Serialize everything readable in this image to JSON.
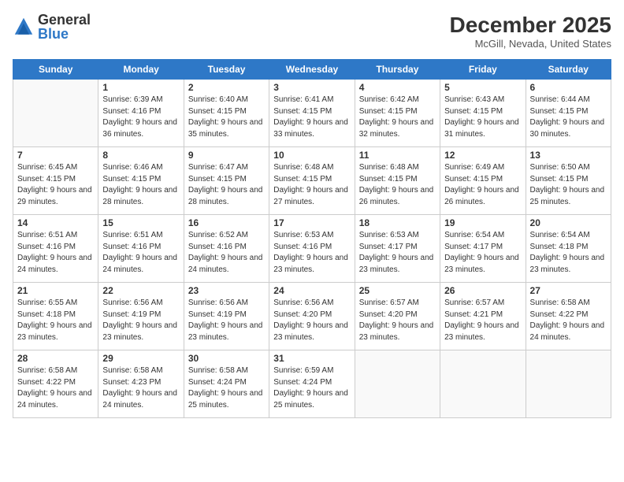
{
  "logo": {
    "general": "General",
    "blue": "Blue"
  },
  "title": "December 2025",
  "location": "McGill, Nevada, United States",
  "days_header": [
    "Sunday",
    "Monday",
    "Tuesday",
    "Wednesday",
    "Thursday",
    "Friday",
    "Saturday"
  ],
  "weeks": [
    [
      {
        "day": "",
        "sunrise": "",
        "sunset": "",
        "daylight": ""
      },
      {
        "day": "1",
        "sunrise": "Sunrise: 6:39 AM",
        "sunset": "Sunset: 4:16 PM",
        "daylight": "Daylight: 9 hours and 36 minutes."
      },
      {
        "day": "2",
        "sunrise": "Sunrise: 6:40 AM",
        "sunset": "Sunset: 4:15 PM",
        "daylight": "Daylight: 9 hours and 35 minutes."
      },
      {
        "day": "3",
        "sunrise": "Sunrise: 6:41 AM",
        "sunset": "Sunset: 4:15 PM",
        "daylight": "Daylight: 9 hours and 33 minutes."
      },
      {
        "day": "4",
        "sunrise": "Sunrise: 6:42 AM",
        "sunset": "Sunset: 4:15 PM",
        "daylight": "Daylight: 9 hours and 32 minutes."
      },
      {
        "day": "5",
        "sunrise": "Sunrise: 6:43 AM",
        "sunset": "Sunset: 4:15 PM",
        "daylight": "Daylight: 9 hours and 31 minutes."
      },
      {
        "day": "6",
        "sunrise": "Sunrise: 6:44 AM",
        "sunset": "Sunset: 4:15 PM",
        "daylight": "Daylight: 9 hours and 30 minutes."
      }
    ],
    [
      {
        "day": "7",
        "sunrise": "Sunrise: 6:45 AM",
        "sunset": "Sunset: 4:15 PM",
        "daylight": "Daylight: 9 hours and 29 minutes."
      },
      {
        "day": "8",
        "sunrise": "Sunrise: 6:46 AM",
        "sunset": "Sunset: 4:15 PM",
        "daylight": "Daylight: 9 hours and 28 minutes."
      },
      {
        "day": "9",
        "sunrise": "Sunrise: 6:47 AM",
        "sunset": "Sunset: 4:15 PM",
        "daylight": "Daylight: 9 hours and 28 minutes."
      },
      {
        "day": "10",
        "sunrise": "Sunrise: 6:48 AM",
        "sunset": "Sunset: 4:15 PM",
        "daylight": "Daylight: 9 hours and 27 minutes."
      },
      {
        "day": "11",
        "sunrise": "Sunrise: 6:48 AM",
        "sunset": "Sunset: 4:15 PM",
        "daylight": "Daylight: 9 hours and 26 minutes."
      },
      {
        "day": "12",
        "sunrise": "Sunrise: 6:49 AM",
        "sunset": "Sunset: 4:15 PM",
        "daylight": "Daylight: 9 hours and 26 minutes."
      },
      {
        "day": "13",
        "sunrise": "Sunrise: 6:50 AM",
        "sunset": "Sunset: 4:15 PM",
        "daylight": "Daylight: 9 hours and 25 minutes."
      }
    ],
    [
      {
        "day": "14",
        "sunrise": "Sunrise: 6:51 AM",
        "sunset": "Sunset: 4:16 PM",
        "daylight": "Daylight: 9 hours and 24 minutes."
      },
      {
        "day": "15",
        "sunrise": "Sunrise: 6:51 AM",
        "sunset": "Sunset: 4:16 PM",
        "daylight": "Daylight: 9 hours and 24 minutes."
      },
      {
        "day": "16",
        "sunrise": "Sunrise: 6:52 AM",
        "sunset": "Sunset: 4:16 PM",
        "daylight": "Daylight: 9 hours and 24 minutes."
      },
      {
        "day": "17",
        "sunrise": "Sunrise: 6:53 AM",
        "sunset": "Sunset: 4:16 PM",
        "daylight": "Daylight: 9 hours and 23 minutes."
      },
      {
        "day": "18",
        "sunrise": "Sunrise: 6:53 AM",
        "sunset": "Sunset: 4:17 PM",
        "daylight": "Daylight: 9 hours and 23 minutes."
      },
      {
        "day": "19",
        "sunrise": "Sunrise: 6:54 AM",
        "sunset": "Sunset: 4:17 PM",
        "daylight": "Daylight: 9 hours and 23 minutes."
      },
      {
        "day": "20",
        "sunrise": "Sunrise: 6:54 AM",
        "sunset": "Sunset: 4:18 PM",
        "daylight": "Daylight: 9 hours and 23 minutes."
      }
    ],
    [
      {
        "day": "21",
        "sunrise": "Sunrise: 6:55 AM",
        "sunset": "Sunset: 4:18 PM",
        "daylight": "Daylight: 9 hours and 23 minutes."
      },
      {
        "day": "22",
        "sunrise": "Sunrise: 6:56 AM",
        "sunset": "Sunset: 4:19 PM",
        "daylight": "Daylight: 9 hours and 23 minutes."
      },
      {
        "day": "23",
        "sunrise": "Sunrise: 6:56 AM",
        "sunset": "Sunset: 4:19 PM",
        "daylight": "Daylight: 9 hours and 23 minutes."
      },
      {
        "day": "24",
        "sunrise": "Sunrise: 6:56 AM",
        "sunset": "Sunset: 4:20 PM",
        "daylight": "Daylight: 9 hours and 23 minutes."
      },
      {
        "day": "25",
        "sunrise": "Sunrise: 6:57 AM",
        "sunset": "Sunset: 4:20 PM",
        "daylight": "Daylight: 9 hours and 23 minutes."
      },
      {
        "day": "26",
        "sunrise": "Sunrise: 6:57 AM",
        "sunset": "Sunset: 4:21 PM",
        "daylight": "Daylight: 9 hours and 23 minutes."
      },
      {
        "day": "27",
        "sunrise": "Sunrise: 6:58 AM",
        "sunset": "Sunset: 4:22 PM",
        "daylight": "Daylight: 9 hours and 24 minutes."
      }
    ],
    [
      {
        "day": "28",
        "sunrise": "Sunrise: 6:58 AM",
        "sunset": "Sunset: 4:22 PM",
        "daylight": "Daylight: 9 hours and 24 minutes."
      },
      {
        "day": "29",
        "sunrise": "Sunrise: 6:58 AM",
        "sunset": "Sunset: 4:23 PM",
        "daylight": "Daylight: 9 hours and 24 minutes."
      },
      {
        "day": "30",
        "sunrise": "Sunrise: 6:58 AM",
        "sunset": "Sunset: 4:24 PM",
        "daylight": "Daylight: 9 hours and 25 minutes."
      },
      {
        "day": "31",
        "sunrise": "Sunrise: 6:59 AM",
        "sunset": "Sunset: 4:24 PM",
        "daylight": "Daylight: 9 hours and 25 minutes."
      },
      {
        "day": "",
        "sunrise": "",
        "sunset": "",
        "daylight": ""
      },
      {
        "day": "",
        "sunrise": "",
        "sunset": "",
        "daylight": ""
      },
      {
        "day": "",
        "sunrise": "",
        "sunset": "",
        "daylight": ""
      }
    ]
  ]
}
